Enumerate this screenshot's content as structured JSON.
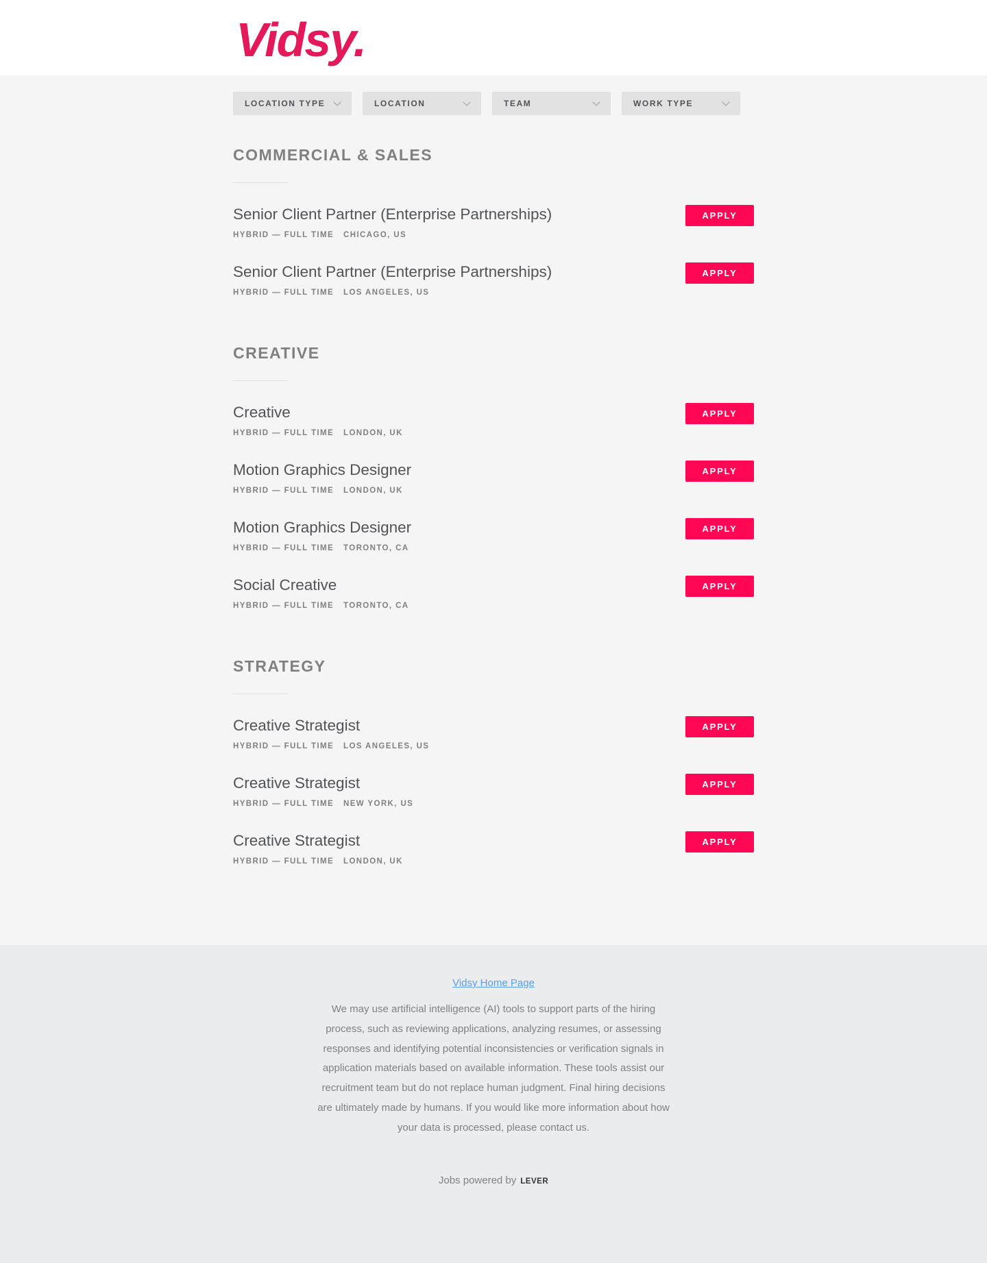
{
  "header": {
    "logo_text": "Vidsy."
  },
  "filters": [
    {
      "label": "LOCATION TYPE"
    },
    {
      "label": "LOCATION"
    },
    {
      "label": "TEAM"
    },
    {
      "label": "WORK TYPE"
    }
  ],
  "groups": [
    {
      "title": "COMMERCIAL & SALES",
      "postings": [
        {
          "title": "Senior Client Partner (Enterprise Partnerships)",
          "work": "HYBRID — FULL TIME",
          "location": "CHICAGO, US",
          "apply": "APPLY"
        },
        {
          "title": "Senior Client Partner (Enterprise Partnerships)",
          "work": "HYBRID — FULL TIME",
          "location": "LOS ANGELES, US",
          "apply": "APPLY"
        }
      ]
    },
    {
      "title": "CREATIVE",
      "postings": [
        {
          "title": "Creative",
          "work": "HYBRID — FULL TIME",
          "location": "LONDON, UK",
          "apply": "APPLY"
        },
        {
          "title": "Motion Graphics Designer",
          "work": "HYBRID — FULL TIME",
          "location": "LONDON, UK",
          "apply": "APPLY"
        },
        {
          "title": "Motion Graphics Designer",
          "work": "HYBRID — FULL TIME",
          "location": "TORONTO, CA",
          "apply": "APPLY"
        },
        {
          "title": "Social Creative",
          "work": "HYBRID — FULL TIME",
          "location": "TORONTO, CA",
          "apply": "APPLY"
        }
      ]
    },
    {
      "title": "STRATEGY",
      "postings": [
        {
          "title": "Creative Strategist",
          "work": "HYBRID — FULL TIME",
          "location": "LOS ANGELES, US",
          "apply": "APPLY"
        },
        {
          "title": "Creative Strategist",
          "work": "HYBRID — FULL TIME",
          "location": "NEW YORK, US",
          "apply": "APPLY"
        },
        {
          "title": "Creative Strategist",
          "work": "HYBRID — FULL TIME",
          "location": "LONDON, UK",
          "apply": "APPLY"
        }
      ]
    }
  ],
  "footer": {
    "home_link": "Vidsy Home Page",
    "ai_notice": "We may use artificial intelligence (AI) tools to support parts of the hiring process, such as reviewing applications, analyzing resumes, or assessing responses and identifying potential inconsistencies or verification signals in application materials based on available information. These tools assist our recruitment team but do not replace human judgment. Final hiring decisions are ultimately made by humans. If you would like more information about how your data is processed, please contact us.",
    "powered_by": "Jobs powered by",
    "powered_brand": "LEVER"
  },
  "colors": {
    "brand": "#e4195a",
    "apply_button": "#ff0755",
    "link": "#579eee"
  }
}
